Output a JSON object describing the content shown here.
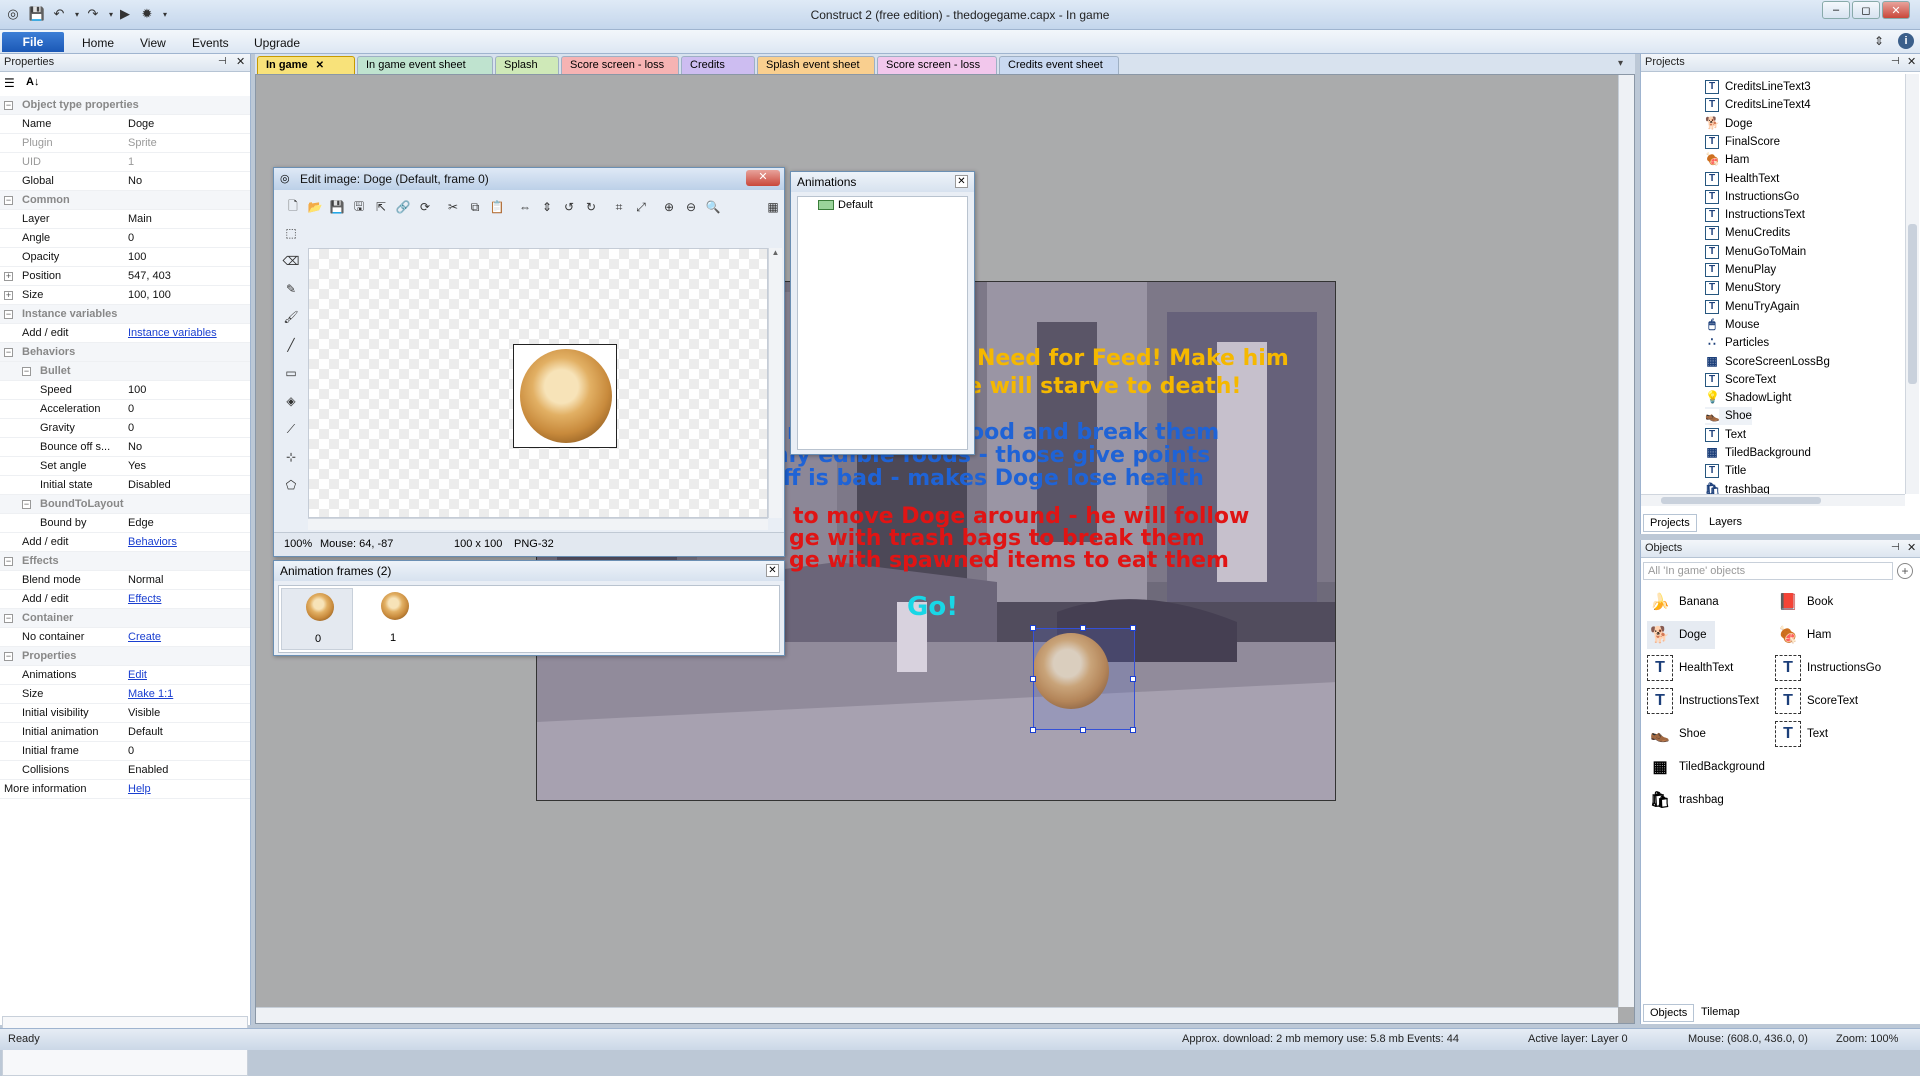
{
  "window": {
    "title": "Construct 2  (free edition) - thedogegame.capx - In game",
    "controls": [
      "–",
      "◻",
      "✕"
    ]
  },
  "ribbon": {
    "file": "File",
    "tabs": [
      "Home",
      "View",
      "Events",
      "Upgrade"
    ]
  },
  "properties": {
    "header": "Properties",
    "rows": [
      {
        "type": "section",
        "label": "Object type properties"
      },
      {
        "label": "Name",
        "value": "Doge"
      },
      {
        "label": "Plugin",
        "value": "Sprite",
        "dim": true
      },
      {
        "label": "UID",
        "value": "1",
        "dim": true
      },
      {
        "label": "Global",
        "value": "No"
      },
      {
        "type": "section",
        "label": "Common"
      },
      {
        "label": "Layer",
        "value": "Main"
      },
      {
        "label": "Angle",
        "value": "0"
      },
      {
        "label": "Opacity",
        "value": "100"
      },
      {
        "label": "Position",
        "value": "547, 403",
        "expand": true
      },
      {
        "label": "Size",
        "value": "100, 100",
        "expand": true
      },
      {
        "type": "section",
        "label": "Instance variables"
      },
      {
        "label": "Add / edit",
        "value": "Instance variables",
        "link": true
      },
      {
        "type": "section",
        "label": "Behaviors"
      },
      {
        "type": "subsection",
        "label": "Bullet"
      },
      {
        "label": "Speed",
        "value": "100",
        "indent": true
      },
      {
        "label": "Acceleration",
        "value": "0",
        "indent": true
      },
      {
        "label": "Gravity",
        "value": "0",
        "indent": true
      },
      {
        "label": "Bounce off s...",
        "value": "No",
        "indent": true
      },
      {
        "label": "Set angle",
        "value": "Yes",
        "indent": true
      },
      {
        "label": "Initial state",
        "value": "Disabled",
        "indent": true
      },
      {
        "type": "subsection",
        "label": "BoundToLayout"
      },
      {
        "label": "Bound by",
        "value": "Edge",
        "indent": true
      },
      {
        "label": "Add / edit",
        "value": "Behaviors",
        "link": true
      },
      {
        "type": "section",
        "label": "Effects"
      },
      {
        "label": "Blend mode",
        "value": "Normal"
      },
      {
        "label": "Add / edit",
        "value": "Effects",
        "link": true
      },
      {
        "type": "section",
        "label": "Container"
      },
      {
        "label": "No container",
        "value": "Create",
        "link": true
      },
      {
        "type": "section",
        "label": "Properties"
      },
      {
        "label": "Animations",
        "value": "Edit",
        "link": true
      },
      {
        "label": "Size",
        "value": "Make 1:1",
        "link": true
      },
      {
        "label": "Initial visibility",
        "value": "Visible"
      },
      {
        "label": "Initial animation",
        "value": "Default"
      },
      {
        "label": "Initial frame",
        "value": "0"
      },
      {
        "label": "Collisions",
        "value": "Enabled"
      },
      {
        "label": "More information",
        "value": "Help",
        "link": true,
        "flush": true
      }
    ]
  },
  "doc_tabs": [
    {
      "label": "In game",
      "color": "#f8e27a",
      "active": true,
      "close": "✕"
    },
    {
      "label": "In game event sheet",
      "color": "#bfe3cf"
    },
    {
      "label": "Splash",
      "color": "#cfe9b8"
    },
    {
      "label": "Score screen - loss",
      "color": "#f6b3b3"
    },
    {
      "label": "Credits",
      "color": "#cdbdf1"
    },
    {
      "label": "Splash event sheet",
      "color": "#f9cf8f"
    },
    {
      "label": "Score screen - loss",
      "color": "#f2c7ec"
    },
    {
      "label": "Credits event sheet",
      "color": "#c9d9f1"
    }
  ],
  "game_text": [
    {
      "text": "Need for Feed! Make him",
      "color": "#f5b800"
    },
    {
      "text": "e will starve to death!",
      "color": "#f5b800"
    },
    {
      "text": "rash bags for food and break them",
      "color": "#1f63d6"
    },
    {
      "text": "nly edible foods - those give points",
      "color": "#1f63d6"
    },
    {
      "text": "uff is bad - makes Doge lose health",
      "color": "#1f63d6"
    },
    {
      "text": "to move Doge around - he will follow",
      "color": "#e01414"
    },
    {
      "text": "ge with trash bags to break them",
      "color": "#e01414"
    },
    {
      "text": "ge with spawned items to eat them",
      "color": "#e01414"
    },
    {
      "text": "Go!",
      "color": "#18d7e6"
    }
  ],
  "edit_image": {
    "title": "Edit image: Doge (Default, frame 0)",
    "status_zoom": "100%",
    "status_mouse": "Mouse: 64, -87",
    "status_size": "100 x 100",
    "status_format": "PNG-32",
    "close": "✕"
  },
  "animations": {
    "title": "Animations",
    "items": [
      "Default"
    ]
  },
  "anim_frames": {
    "title": "Animation frames (2)",
    "frames": [
      "0",
      "1"
    ]
  },
  "projects": {
    "header": "Projects",
    "items": [
      {
        "label": "CreditsLineText3",
        "icon": "T"
      },
      {
        "label": "CreditsLineText4",
        "icon": "T"
      },
      {
        "label": "Doge",
        "icon": "dog"
      },
      {
        "label": "FinalScore",
        "icon": "T"
      },
      {
        "label": "Ham",
        "icon": "ham"
      },
      {
        "label": "HealthText",
        "icon": "T"
      },
      {
        "label": "InstructionsGo",
        "icon": "T"
      },
      {
        "label": "InstructionsText",
        "icon": "T"
      },
      {
        "label": "MenuCredits",
        "icon": "T"
      },
      {
        "label": "MenuGoToMain",
        "icon": "T"
      },
      {
        "label": "MenuPlay",
        "icon": "T"
      },
      {
        "label": "MenuStory",
        "icon": "T"
      },
      {
        "label": "MenuTryAgain",
        "icon": "T"
      },
      {
        "label": "Mouse",
        "icon": "mouse"
      },
      {
        "label": "Particles",
        "icon": "particles"
      },
      {
        "label": "ScoreScreenLossBg",
        "icon": "img"
      },
      {
        "label": "ScoreText",
        "icon": "T"
      },
      {
        "label": "ShadowLight",
        "icon": "bulb"
      },
      {
        "label": "Shoe",
        "icon": "shoe"
      },
      {
        "label": "Text",
        "icon": "T"
      },
      {
        "label": "TiledBackground",
        "icon": "img"
      },
      {
        "label": "Title",
        "icon": "T"
      },
      {
        "label": "trashbag",
        "icon": "bag"
      }
    ],
    "tabs": [
      "Projects",
      "Layers"
    ]
  },
  "objects": {
    "header": "Objects",
    "filter_placeholder": "All 'In game' objects",
    "items": [
      {
        "label": "Banana",
        "icon": "banana"
      },
      {
        "label": "Book",
        "icon": "book"
      },
      {
        "label": "Doge",
        "icon": "dog"
      },
      {
        "label": "Ham",
        "icon": "ham"
      },
      {
        "label": "HealthText",
        "icon": "T"
      },
      {
        "label": "InstructionsGo",
        "icon": "T"
      },
      {
        "label": "InstructionsText",
        "icon": "T"
      },
      {
        "label": "ScoreText",
        "icon": "T"
      },
      {
        "label": "Shoe",
        "icon": "shoe"
      },
      {
        "label": "Text",
        "icon": "T"
      },
      {
        "label": "TiledBackground",
        "icon": "img"
      },
      {
        "label": "trashbag",
        "icon": "bag"
      }
    ],
    "tabs": [
      "Objects",
      "Tilemap"
    ]
  },
  "status": {
    "ready": "Ready",
    "download": "Approx. download: 2 mb  memory use: 5.8 mb  Events: 44",
    "layer": "Active layer: Layer 0",
    "mouse": "Mouse: (608.0, 436.0, 0)",
    "zoom": "Zoom: 100%"
  }
}
